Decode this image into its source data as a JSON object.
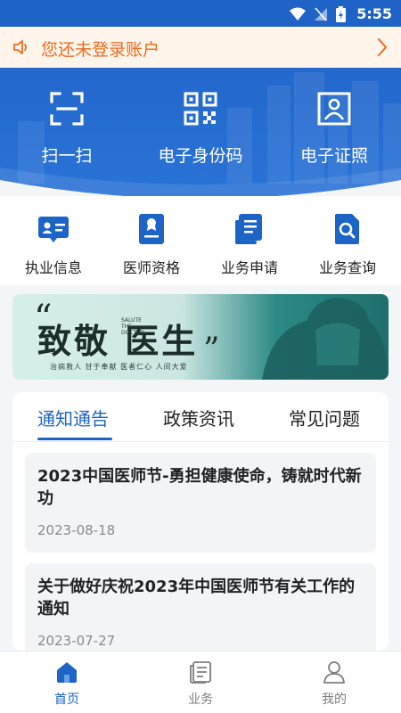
{
  "status_bar": {
    "time": "5:55"
  },
  "notice": {
    "text": "您还未登录账户"
  },
  "hero": {
    "items": [
      {
        "label": "扫一扫",
        "icon": "scan-icon"
      },
      {
        "label": "电子身份码",
        "icon": "qr-code-icon"
      },
      {
        "label": "电子证照",
        "icon": "certificate-icon"
      }
    ]
  },
  "quick": {
    "items": [
      {
        "label": "执业信息",
        "icon": "id-card-icon"
      },
      {
        "label": "医师资格",
        "icon": "certificate-badge-icon"
      },
      {
        "label": "业务申请",
        "icon": "document-list-icon"
      },
      {
        "label": "业务查询",
        "icon": "document-search-icon"
      }
    ]
  },
  "banner": {
    "headline": "致敬 医生",
    "salute": "SALUTE THE DOCTOR",
    "subtitle": "治病救人  甘于奉献    医者仁心  人间大爱"
  },
  "news": {
    "tabs": [
      "通知通告",
      "政策资讯",
      "常见问题"
    ],
    "active_tab": 0,
    "items": [
      {
        "title": "2023中国医师节-勇担健康使命，铸就时代新功",
        "date": "2023-08-18"
      },
      {
        "title": "关于做好庆祝2023年中国医师节有关工作的通知",
        "date": "2023-07-27"
      }
    ]
  },
  "bottom_nav": {
    "items": [
      {
        "label": "首页",
        "icon": "home-icon",
        "active": true
      },
      {
        "label": "业务",
        "icon": "business-icon",
        "active": false
      },
      {
        "label": "我的",
        "icon": "profile-icon",
        "active": false
      }
    ]
  },
  "colors": {
    "primary": "#1d64c7",
    "hero_bg": "#2368cc",
    "notice_bg": "#fff5ea",
    "notice_text": "#ee6a1f"
  }
}
